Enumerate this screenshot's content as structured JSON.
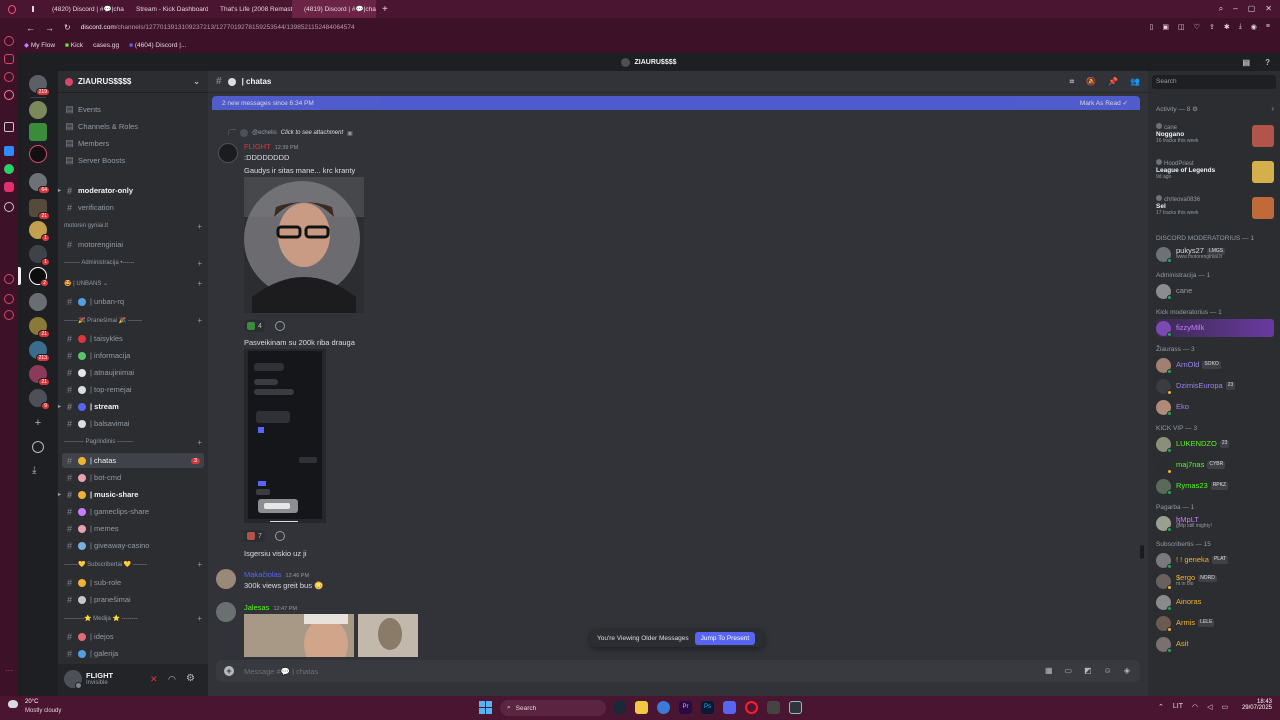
{
  "browser": {
    "tabs": [
      {
        "label": "(4820) Discord | #💬|cha",
        "color": "#5865f2"
      },
      {
        "label": "Stream - Kick Dashboard",
        "color": "#53fc18"
      },
      {
        "label": "That's Life (2008 Remast",
        "color": "#ff0033"
      },
      {
        "label": "(4819) Discord | #💬|cha",
        "color": "#5865f2",
        "active": true
      }
    ],
    "url_host": "discord.com",
    "url_path": "/channels/1277013913109237213/1277019278159253544/1398521152484064574",
    "bookmarks": [
      "My Flow",
      "Kick",
      "cases.gg",
      "(4604) Discord |..."
    ]
  },
  "server": {
    "name": "ZIAURUS$$$$",
    "top_title": "ZIAURU$$$$"
  },
  "guild_badges": [
    "219",
    "64",
    "21",
    "1",
    "1",
    "2",
    "21",
    "213",
    "21",
    "9"
  ],
  "sidebar": {
    "server_items": [
      "Events",
      "Channels & Roles",
      "Members",
      "Server Boosts"
    ],
    "channels": [
      {
        "label": "moderator-only",
        "bold": true,
        "arrow": true
      },
      {
        "label": "verification"
      },
      {
        "category": "motoren gyniai.lt"
      },
      {
        "label": "motorenginiai"
      },
      {
        "category": "-------- Administracija •------"
      },
      {
        "category": "🤩 | UNBANS ⌄"
      },
      {
        "label": "| unban-rq"
      },
      {
        "category": "-------🎉 Pranešimai 🎉 -------"
      },
      {
        "label": "| taisyklės"
      },
      {
        "label": "| informacija"
      },
      {
        "label": "| atnaujinimai"
      },
      {
        "label": "| top-remėjai"
      },
      {
        "label": "| stream",
        "bold": true,
        "arrow": true
      },
      {
        "label": "| balsavimai"
      },
      {
        "category": "---------- Pagrindinis --------"
      },
      {
        "label": "| chatas",
        "active": true,
        "badge": "3"
      },
      {
        "label": "| bot-cmd"
      },
      {
        "label": "| music-share",
        "bold": true,
        "arrow": true
      },
      {
        "label": "| gameclips-share"
      },
      {
        "label": "| memes"
      },
      {
        "label": "| giveaway-casino"
      },
      {
        "category": "-------💛 Subscribertai 💛 -------"
      },
      {
        "label": "| sub-role"
      },
      {
        "label": "| pranešimai"
      },
      {
        "category": "----------⭐ Medija ⭐ --------"
      },
      {
        "label": "| idejos"
      },
      {
        "label": "| galerija"
      }
    ]
  },
  "user": {
    "name": "FLIGHT",
    "status": "Invisible"
  },
  "chat": {
    "channel_name": "| chatas",
    "new_messages": "2 new messages since 6:34 PM",
    "mark_as_read": "Mark As Read",
    "reply_name": "@echelis",
    "reply_text": "Click to see attachment",
    "messages": [
      {
        "author": "FLIGHT",
        "time": "12:39 PM",
        "lines": [
          ":DDDDDDDD",
          "Gaudys ir sitas mane... krc kranty"
        ]
      },
      {
        "caption": "Pasveikinam su 200k riba drauga"
      },
      {
        "caption": "Isgersiu viskio uz ji"
      },
      {
        "author": "Makačiolas",
        "time": "12:46 PM",
        "lines": [
          "300k views greit bus 😳"
        ]
      },
      {
        "author": "Jalesas",
        "time": "12:47 PM"
      }
    ],
    "reactions": [
      {
        "count": "4"
      },
      {
        "count": "7"
      }
    ],
    "composer_placeholder": "Message #💬 | chatas",
    "older_notice": "You're Viewing Older Messages",
    "jump_label": "Jump To Present"
  },
  "members": {
    "search_placeholder": "Search",
    "activity_title": "Activity — 8",
    "activities": [
      {
        "user": "cane",
        "title": "Noggano",
        "sub": "16 tracks this week"
      },
      {
        "user": "HoodPriest",
        "title": "League of Legends",
        "sub": "9d ago"
      },
      {
        "user": "chrleova0836",
        "title": "Sel",
        "sub": "17 tracks this week"
      }
    ],
    "groups": [
      {
        "title": "DISCORD MODERATORIUS — 1",
        "members": [
          {
            "name": "pukys27",
            "tag": "LMGS",
            "sub": "www.motorenginiai.lt",
            "color": "#dbdee1"
          }
        ]
      },
      {
        "title": "Administracija — 1",
        "members": [
          {
            "name": "cane",
            "color": "#949ba4"
          }
        ]
      },
      {
        "title": "Kick moderatorius — 1",
        "members": [
          {
            "name": "fizzyMilk",
            "color": "#c77dff"
          }
        ]
      },
      {
        "title": "Žiaurass — 3",
        "members": [
          {
            "name": "ArnOld",
            "tag": "SOKO",
            "color": "#9b84ec"
          },
          {
            "name": "DzimisEuropa",
            "tag": "23",
            "color": "#9b84ec"
          },
          {
            "name": "Eko",
            "color": "#9b84ec"
          }
        ]
      },
      {
        "title": "KICK VIP — 3",
        "members": [
          {
            "name": "LUKENDZO",
            "tag": "23",
            "color": "#53fc18"
          },
          {
            "name": "maj7nas",
            "tag": "CYBR",
            "color": "#53fc18"
          },
          {
            "name": "Rymas23",
            "tag": "RPKZ",
            "color": "#53fc18"
          }
        ]
      },
      {
        "title": "Pagarba — 1",
        "members": [
          {
            "name": "ɮMpLT",
            "sub": "gMp still mighty!",
            "color": "#c77dff"
          }
        ]
      },
      {
        "title": "Subscribertis — 15",
        "members": [
          {
            "name": "! ! geneka",
            "tag": "PLAT",
            "color": "#f0b232"
          },
          {
            "name": "$ergo",
            "tag": "NORD",
            "sub": "nt in bio",
            "color": "#f0b232"
          },
          {
            "name": "Ainoras",
            "color": "#f0b232"
          },
          {
            "name": "Armis",
            "tag": "LELE",
            "color": "#f0b232"
          },
          {
            "name": "Asit",
            "color": "#f0b232"
          }
        ]
      }
    ]
  },
  "taskbar": {
    "weather_temp": "20°C",
    "weather_desc": "Mostly cloudy",
    "search": "Search",
    "lang": "LIT",
    "time": "18:43",
    "date": "29/07/2025"
  }
}
